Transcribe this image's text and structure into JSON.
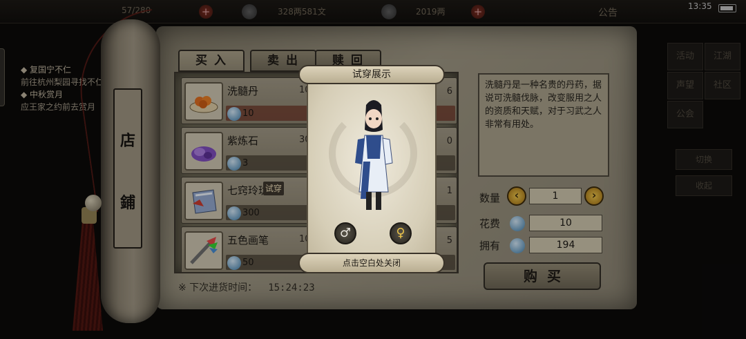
{
  "status_bar": {
    "stamina": "57/280",
    "money": "328两581文",
    "gold": "2019两",
    "announcement": "公告",
    "time": "13:35"
  },
  "quest_panel": {
    "quests": [
      {
        "title": "◆ 复国宁不仁",
        "detail": "前往杭州梨园寻找不仁"
      },
      {
        "title": "◆ 中秋赏月",
        "detail": "应王家之约前去赏月"
      }
    ]
  },
  "scroll_label": {
    "chars": [
      "店",
      "鋪"
    ]
  },
  "shop": {
    "tabs": [
      {
        "label": "买入",
        "active": true
      },
      {
        "label": "卖出",
        "active": false
      },
      {
        "label": "赎回",
        "active": false
      }
    ],
    "items": [
      {
        "name": "洗髓丹",
        "stock": "10",
        "price": "10",
        "count": "6",
        "selected": true,
        "trial": ""
      },
      {
        "name": "紫炼石",
        "stock": "30",
        "price": "3",
        "count": "0",
        "selected": false,
        "trial": ""
      },
      {
        "name": "七窍玲珑衣",
        "stock": "",
        "price": "300",
        "count": "1",
        "selected": false,
        "trial": "试穿"
      },
      {
        "name": "五色画笔",
        "stock": "10",
        "price": "50",
        "count": "5",
        "selected": false,
        "trial": ""
      }
    ],
    "restock_label": "※ 下次进货时间：",
    "restock_time": "15:24:23"
  },
  "detail": {
    "description": "洗髓丹是一种名贵的丹药，据说可洗髓伐脉，改变服用之人的资质和天赋，对于习武之人非常有用处。",
    "quantity_label": "数量",
    "quantity": "1",
    "cost_label": "花费",
    "cost": "10",
    "owned_label": "拥有",
    "owned": "194",
    "buy_label": "购买"
  },
  "right_menu": {
    "buttons": [
      "活动",
      "江湖",
      "声望",
      "社区",
      "公会"
    ],
    "wide_buttons": [
      "切换",
      "收起"
    ]
  },
  "popup": {
    "title": "试穿展示",
    "footer": "点击空白处关闭",
    "male_symbol": "♂",
    "female_symbol": "♀"
  },
  "colors": {
    "parchment": "#9a9380",
    "dark_bg": "#0b0a09",
    "gem_blue": "#3c7aa6",
    "gender_gold": "#e8c14a"
  }
}
